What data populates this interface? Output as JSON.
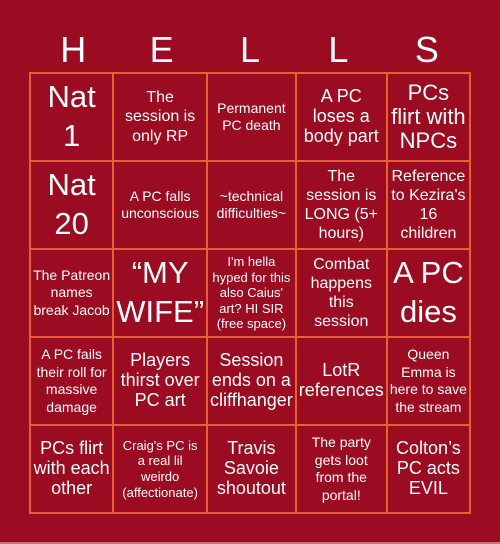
{
  "header": {
    "letters": [
      "H",
      "E",
      "L",
      "L",
      "S"
    ]
  },
  "cells": [
    {
      "text": "Nat\n1"
    },
    {
      "text": "The\nsession is\nonly RP"
    },
    {
      "text": "Permanent\nPC death"
    },
    {
      "text": "A PC\nloses a\nbody part"
    },
    {
      "text": "PCs\nflirt with\nNPCs"
    },
    {
      "text": "Nat\n20"
    },
    {
      "text": "A PC falls\nunconscious"
    },
    {
      "text": "~technical\ndifficulties~"
    },
    {
      "text": "The\nsession is\nLONG (5+\nhours)"
    },
    {
      "text": "Reference\nto Kezira's\n16\nchildren"
    },
    {
      "text": "The Patreon\nnames\nbreak Jacob"
    },
    {
      "text": "“MY\nWIFE”"
    },
    {
      "text": "I'm hella\nhyped for this\nalso Caius'\nart? HI SIR\n(free space)"
    },
    {
      "text": "Combat\nhappens\nthis\nsession"
    },
    {
      "text": "A PC\ndies"
    },
    {
      "text": "A PC fails\ntheir roll for\nmassive\ndamage"
    },
    {
      "text": "Players\nthirst over\nPC art"
    },
    {
      "text": "Session\nends on a\ncliffhanger"
    },
    {
      "text": "LotR\nreferences"
    },
    {
      "text": "Queen\nEmma is\nhere to save\nthe stream"
    },
    {
      "text": "PCs flirt\nwith each\nother"
    },
    {
      "text": "Craig's PC is\na real lil\nweirdo\n(affectionate)"
    },
    {
      "text": "Travis\nSavoie\nshoutout"
    },
    {
      "text": "The party\ngets loot\nfrom the\nportal!"
    },
    {
      "text": "Colton’s\nPC acts\nEVIL"
    }
  ],
  "colors": {
    "background": "#9b0b21",
    "grid_line": "#e8602c",
    "text": "#ffffff"
  }
}
